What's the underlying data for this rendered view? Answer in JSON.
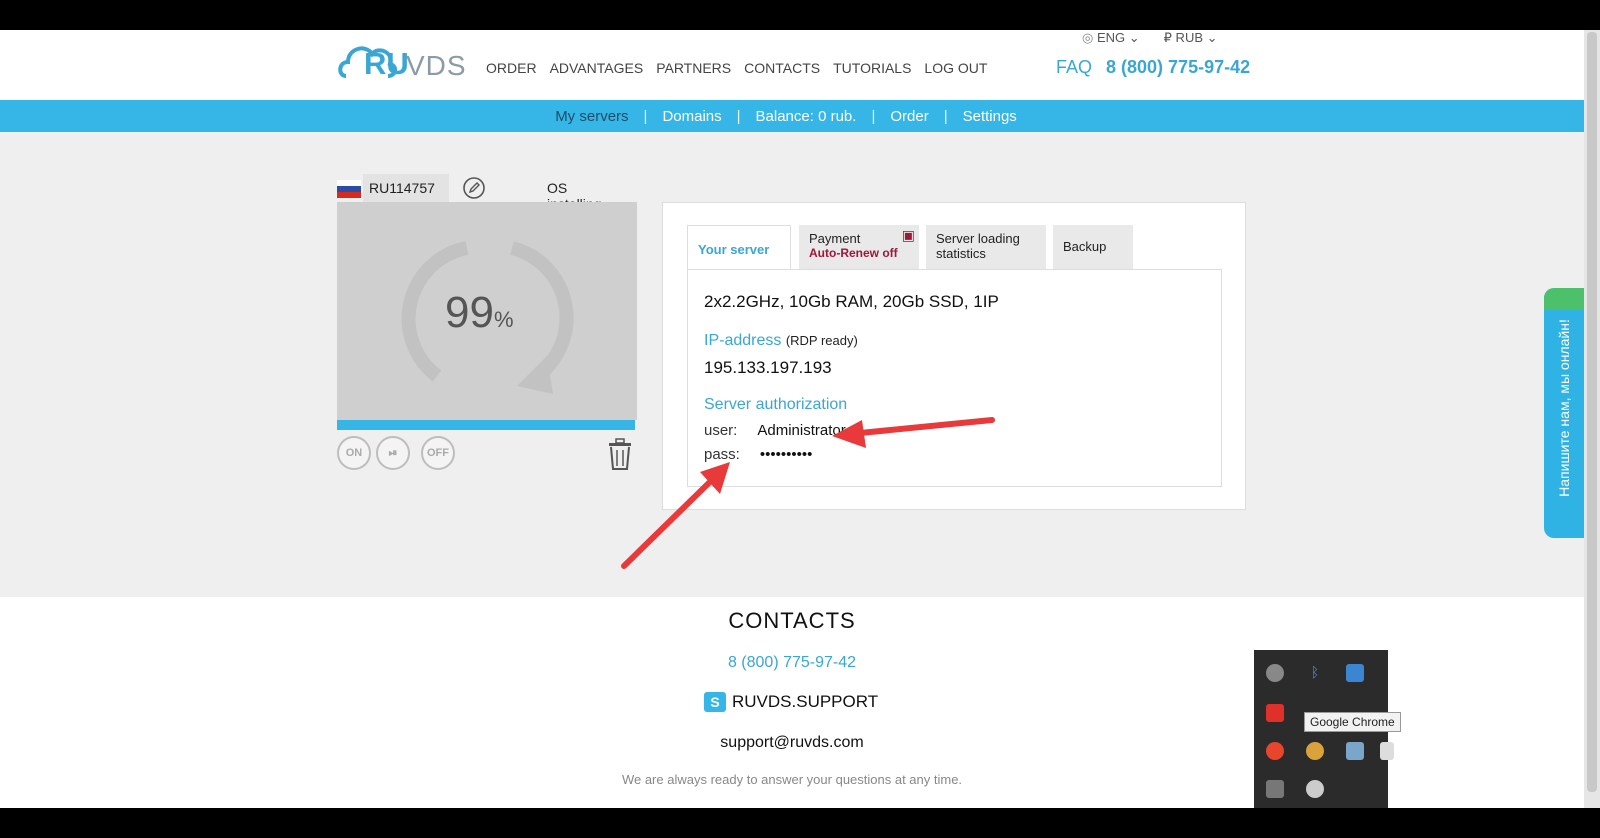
{
  "header": {
    "logo": {
      "ru": "RU",
      "vds": "VDS"
    },
    "nav": [
      "ORDER",
      "ADVANTAGES",
      "PARTNERS",
      "CONTACTS",
      "TUTORIALS",
      "LOG OUT"
    ],
    "language": "ENG",
    "currency": "₽ RUB",
    "faq": "FAQ",
    "phone": "8 (800) 775-97-42"
  },
  "subnav": {
    "items": [
      "My servers",
      "Domains",
      "Balance: 0 rub.",
      "Order",
      "Settings"
    ],
    "separator": "|"
  },
  "server": {
    "id": "RU114757",
    "status": "OS installing...",
    "progress_percent": "99",
    "percent_sign": "%",
    "controls": [
      "ON",
      "OFF"
    ],
    "flag_colors": [
      "#ffffff",
      "#2a4ea6",
      "#d52b1e"
    ]
  },
  "tabs": [
    {
      "label": "Your server",
      "warning": ""
    },
    {
      "label": "Payment",
      "warning": "Auto-Renew off"
    },
    {
      "label": "Server loading statistics",
      "warning": ""
    },
    {
      "label": "Backup",
      "warning": ""
    }
  ],
  "details": {
    "spec": "2x2.2GHz, 10Gb RAM, 20Gb SSD, 1IP",
    "ip_label": "IP-address",
    "ip_note": "(RDP ready)",
    "ip": "195.133.197.193",
    "auth_label": "Server authorization",
    "user_label": "user:",
    "user_value": "Administrator",
    "pass_label": "pass:",
    "pass_value": "••••••••••"
  },
  "contacts": {
    "title": "CONTACTS",
    "phone": "8 (800) 775-97-42",
    "skype": "RUVDS.SUPPORT",
    "email": "support@ruvds.com",
    "note": "We are always ready to answer your questions at any time."
  },
  "chat": {
    "label": "Напишите нам, мы онлайн!"
  },
  "tray": {
    "tooltip": "Google Chrome"
  },
  "colors": {
    "accent": "#35b6e6",
    "warning": "#a0173c",
    "arrow": "#e83a3a"
  }
}
